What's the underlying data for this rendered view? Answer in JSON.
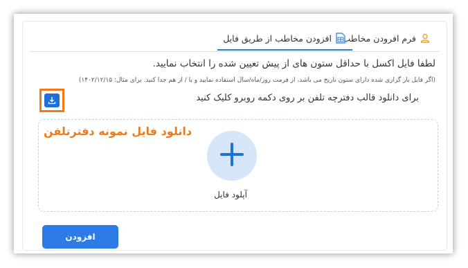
{
  "tabs": [
    {
      "label": "فرم افرودن مخاطب",
      "icon": "user-icon",
      "active": false
    },
    {
      "label": "افزودن مخاطب از طریق فایل",
      "icon": "file-spreadsheet-icon",
      "active": true
    }
  ],
  "instructions": {
    "main": "لطفا فایل اکسل با حداقل ستون های از پیش تعیین شده را انتخاب نمایید.",
    "note": "(اگر فایل بار گزاری شده دارای ستون تاریخ می باشد، از فرمت روز/ماه/سال استفاده نمایید و با / از هم جدا کنید. برای مثال: ۱۴۰۲/۱۲/۱۵)",
    "download_hint": "برای دانلود قالب دفترچه تلفن بر روی دکمه روبرو کلیک کنید"
  },
  "download_button": {
    "icon": "download-icon"
  },
  "annotation": "دانلود فایل نمونه دفترتلفن",
  "dropzone": {
    "icon": "plus-icon",
    "label": "آپلود فایل"
  },
  "submit_button": {
    "label": "افزودن"
  },
  "colors": {
    "accent": "#2b7cd3",
    "highlight": "#f07a1a",
    "button": "#2d7be5",
    "circle": "#d4e6f8"
  }
}
